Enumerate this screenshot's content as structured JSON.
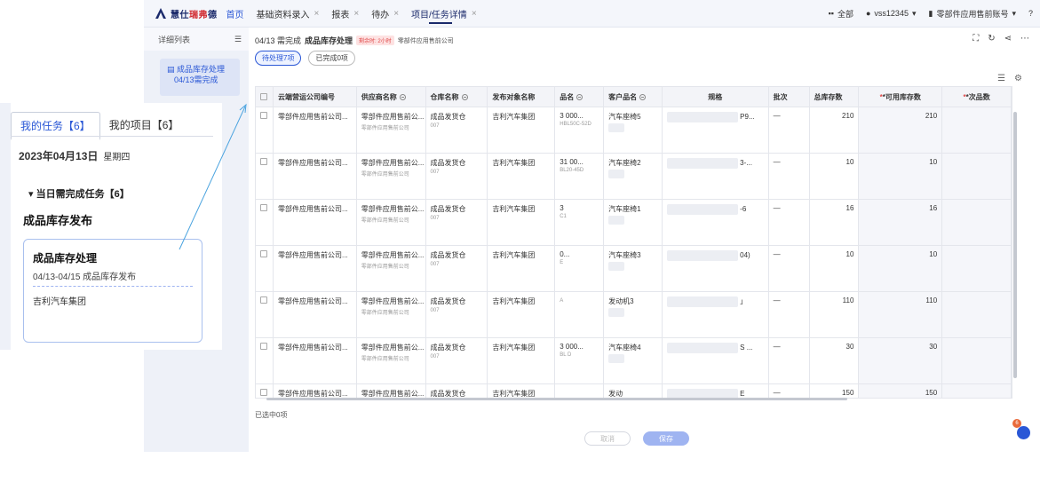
{
  "topbar": {
    "logo_a": "慧仕",
    "logo_b": "瑞弗",
    "logo_c": "德",
    "home": "首页",
    "tabs": [
      {
        "label": "基础资料录入",
        "close": "×"
      },
      {
        "label": "报表",
        "close": "×"
      },
      {
        "label": "待办",
        "close": "×"
      },
      {
        "label": "项目/任务详情",
        "close": "×"
      }
    ],
    "filter": "全部",
    "user": "vss12345",
    "org": "零部件应用售前账号",
    "caret": "▾"
  },
  "sidebar": {
    "title": "详细列表",
    "menu_icon": "☰",
    "item_title": "成品库存处理",
    "item_sub": "04/13需完成"
  },
  "main": {
    "date_prefix": "04/13 需完成",
    "title": "成品库存处理",
    "badge": "剩余时: 2小时",
    "company": "零部件应用售前公司",
    "pills": [
      "待处理7项",
      "已完成0项"
    ],
    "selected": "已选中0项",
    "cancel": "取消",
    "save": "保存",
    "chat_count": "6"
  },
  "table": {
    "headers": [
      "云端营运公司编号",
      "供应商名称",
      "仓库名称",
      "发布对象名称",
      "品名",
      "客户品名",
      "规格",
      "批次",
      "总库存数",
      "*可用库存数",
      "*次品数"
    ],
    "rows": [
      {
        "company": "零部件应用售前公司...",
        "supplier": "零部件应用售前公...",
        "supplier_sub": "零部件应用售前公司",
        "warehouse": "成品发货仓",
        "wh_code": "007",
        "target": "吉利汽车集团",
        "product": "3     000...",
        "product_sub": "HBL50C-52D",
        "cust": "汽车座椅5",
        "spec": "P9...",
        "batch": "—",
        "total": "210",
        "avail": "210"
      },
      {
        "company": "零部件应用售前公司...",
        "supplier": "零部件应用售前公...",
        "supplier_sub": "零部件应用售前公司",
        "warehouse": "成品发货仓",
        "wh_code": "007",
        "target": "吉利汽车集团",
        "product": "31      00...",
        "product_sub": "BL20-45D",
        "cust": "汽车座椅2",
        "spec": "3-...",
        "batch": "—",
        "total": "10",
        "avail": "10"
      },
      {
        "company": "零部件应用售前公司...",
        "supplier": "零部件应用售前公...",
        "supplier_sub": "零部件应用售前公司",
        "warehouse": "成品发货仓",
        "wh_code": "007",
        "target": "吉利汽车集团",
        "product": "3",
        "product_sub": "C1",
        "cust": "汽车座椅1",
        "spec": "-6",
        "batch": "—",
        "total": "16",
        "avail": "16"
      },
      {
        "company": "零部件应用售前公司...",
        "supplier": "零部件应用售前公...",
        "supplier_sub": "零部件应用售前公司",
        "warehouse": "成品发货仓",
        "wh_code": "007",
        "target": "吉利汽车集团",
        "product": "0...",
        "product_sub": "E",
        "cust": "汽车座椅3",
        "spec": "04)",
        "batch": "—",
        "total": "10",
        "avail": "10"
      },
      {
        "company": "零部件应用售前公司...",
        "supplier": "零部件应用售前公...",
        "supplier_sub": "零部件应用售前公司",
        "warehouse": "成品发货仓",
        "wh_code": "007",
        "target": "吉利汽车集团",
        "product": "",
        "product_sub": "A",
        "cust": "发动机3",
        "spec": "」",
        "batch": "—",
        "total": "110",
        "avail": "110"
      },
      {
        "company": "零部件应用售前公司...",
        "supplier": "零部件应用售前公...",
        "supplier_sub": "零部件应用售前公司",
        "warehouse": "成品发货仓",
        "wh_code": "007",
        "target": "吉利汽车集团",
        "product": "3     000...",
        "product_sub": "BL   D",
        "cust": "汽车座椅4",
        "spec": "S  ...",
        "batch": "—",
        "total": "30",
        "avail": "30"
      },
      {
        "company": "零部件应用售前公司...",
        "supplier": "零部件应用售前公...",
        "supplier_sub": "零部件应用售前公司",
        "warehouse": "成品发货仓",
        "wh_code": "007",
        "target": "吉利汽车集团",
        "product": "",
        "product_sub": "",
        "cust": "发动",
        "spec": "E",
        "batch": "—",
        "total": "150",
        "avail": "150"
      }
    ]
  },
  "overlay": {
    "tab_tasks": "我的任务【6】",
    "tab_projects": "我的项目【6】",
    "date": "2023年04月13日",
    "weekday": "星期四",
    "section": "▾ 当日需完成任务【6】",
    "group_title": "成品库存发布",
    "card_title": "成品库存处理",
    "card_dates": "04/13-04/15 成品库存发布",
    "card_group": "吉利汽车集团"
  },
  "colors": {
    "accent": "#2a57d6",
    "brand": "#1b2a6b",
    "danger": "#e04a4a"
  }
}
